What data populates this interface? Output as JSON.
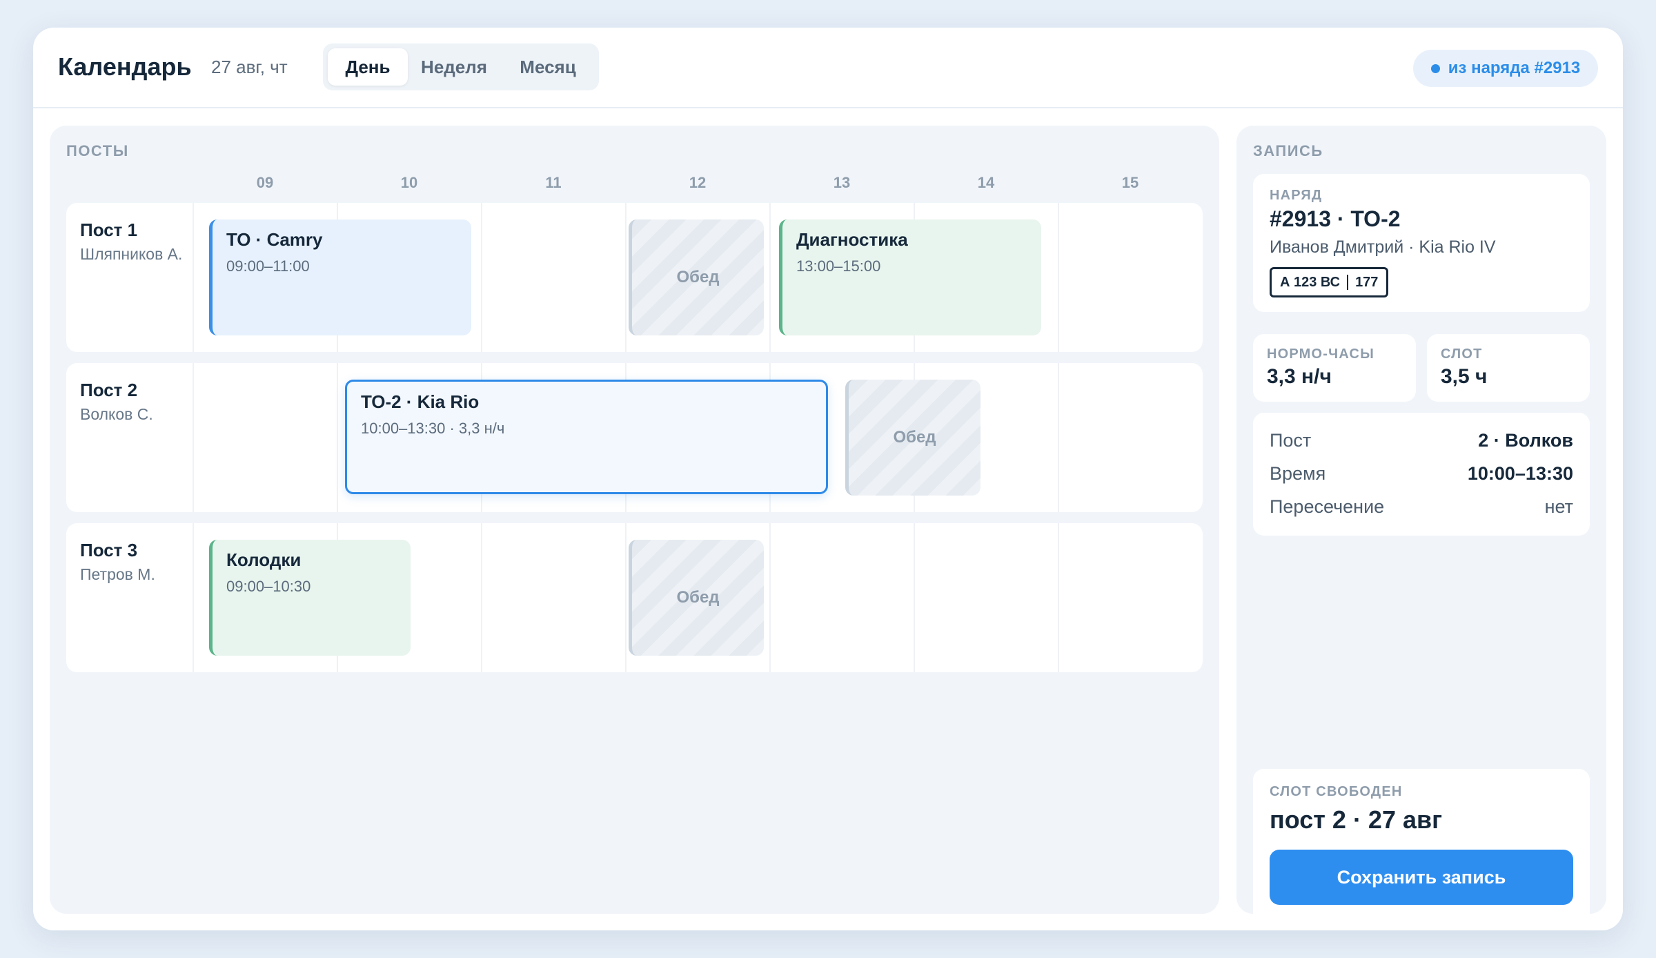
{
  "header": {
    "title": "Календарь",
    "date": "27 авг, чт",
    "views": [
      "День",
      "Неделя",
      "Месяц"
    ],
    "active_view": "День",
    "order_chip": "из наряда #2913"
  },
  "schedule": {
    "section_label": "ПОСТЫ",
    "hours": [
      "09",
      "10",
      "11",
      "12",
      "13",
      "14",
      "15"
    ],
    "posts": [
      {
        "name": "Пост 1",
        "tech": "Шляпников А.",
        "events": [
          {
            "title": "ТО · Camry",
            "time": "09:00–11:00",
            "kind": "blue"
          },
          {
            "title": "Обед",
            "kind": "lunch"
          },
          {
            "title": "Диагностика",
            "time": "13:00–15:00",
            "kind": "green"
          }
        ]
      },
      {
        "name": "Пост 2",
        "tech": "Волков С.",
        "events": [
          {
            "title": "ТО-2 · Kia Rio",
            "time": "10:00–13:30 · 3,3 н/ч",
            "kind": "selected"
          },
          {
            "title": "Обед",
            "kind": "lunch"
          }
        ]
      },
      {
        "name": "Пост 3",
        "tech": "Петров М.",
        "events": [
          {
            "title": "Колодки",
            "time": "09:00–10:30",
            "kind": "green"
          },
          {
            "title": "Обед",
            "kind": "lunch"
          }
        ]
      }
    ]
  },
  "record": {
    "section_label": "ЗАПИСЬ",
    "order": {
      "label": "НАРЯД",
      "title": "#2913 · ТО-2",
      "subtitle": "Иванов Дмитрий · Kia Rio IV",
      "plate_number": "А 123 ВС",
      "plate_region": "177"
    },
    "norm_hours": {
      "label": "НОРМО-ЧАСЫ",
      "value": "3,3 н/ч"
    },
    "slot": {
      "label": "СЛОТ",
      "value": "3,5 ч"
    },
    "details": [
      {
        "key": "Пост",
        "value": "2 · Волков"
      },
      {
        "key": "Время",
        "value": "10:00–13:30"
      },
      {
        "key": "Пересечение",
        "value": "нет"
      }
    ],
    "status": {
      "label": "СЛОТ СВОБОДЕН",
      "title": "пост 2 · 27 авг",
      "save_label": "Сохранить запись"
    }
  },
  "colors": {
    "accent": "#2e8ef0",
    "event_blue": "#3a8fe6",
    "event_green": "#5bb48a"
  }
}
